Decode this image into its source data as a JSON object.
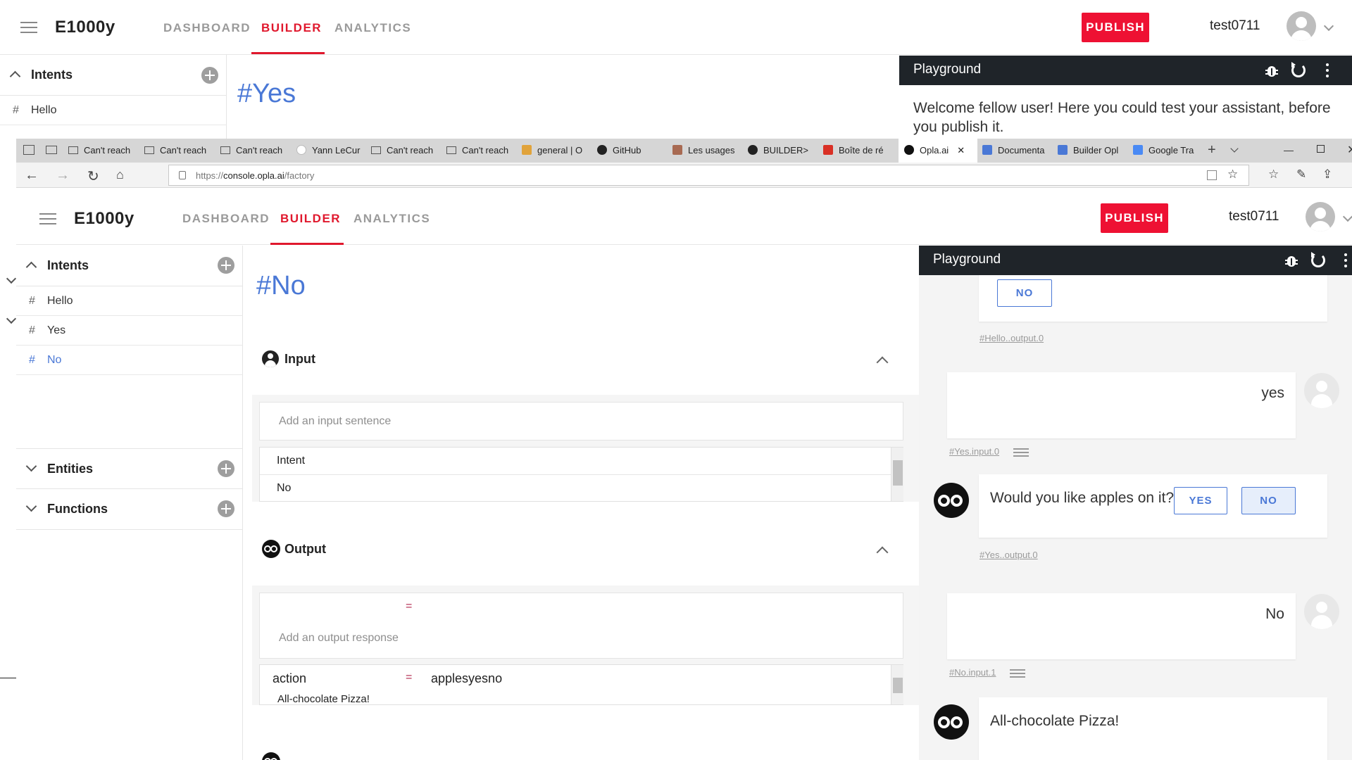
{
  "app": {
    "brand": "E1000y",
    "tabs": [
      "DASHBOARD",
      "BUILDER",
      "ANALYTICS"
    ],
    "publish_label": "PUBLISH",
    "username": "test0711"
  },
  "back": {
    "sidebar": {
      "intents_label": "Intents",
      "items": [
        {
          "hash": "#",
          "label": "Hello"
        }
      ]
    },
    "page_title": "#Yes",
    "playground": {
      "title": "Playground",
      "welcome": "Welcome fellow user! Here you could test your assistant, before you publish it."
    }
  },
  "browser": {
    "tabs": [
      {
        "label": "Can't reach"
      },
      {
        "label": "Can't reach"
      },
      {
        "label": "Can't reach"
      },
      {
        "label": "Yann LeCur"
      },
      {
        "label": "Can't reach"
      },
      {
        "label": "Can't reach"
      },
      {
        "label": "general | O"
      },
      {
        "label": "GitHub"
      },
      {
        "label": "Les usages"
      },
      {
        "label": "BUILDER>"
      },
      {
        "label": "Boîte de ré"
      },
      {
        "label": "Opla.ai"
      },
      {
        "label": "Documenta"
      },
      {
        "label": "Builder Opl"
      },
      {
        "label": "Google Tra"
      }
    ],
    "url_prefix": "https://",
    "url_host": "console.opla.ai",
    "url_path": "/factory"
  },
  "front": {
    "sidebar": {
      "intents_label": "Intents",
      "items": [
        {
          "hash": "#",
          "label": "Hello"
        },
        {
          "hash": "#",
          "label": "Yes"
        },
        {
          "hash": "#",
          "label": "No"
        }
      ],
      "entities_label": "Entities",
      "functions_label": "Functions"
    },
    "page_title": "#No",
    "input": {
      "title": "Input",
      "placeholder": "Add an input sentence",
      "rows": [
        "Intent",
        "No"
      ]
    },
    "output": {
      "title": "Output",
      "equals": "=",
      "placeholder": "Add an output response",
      "action_key": "action",
      "action_value": "applesyesno",
      "response": "All-chocolate Pizza!"
    },
    "playground": {
      "title": "Playground",
      "top_no_label": "NO",
      "link1": "#Hello..output.0",
      "user_msg1": "yes",
      "link2": "#Yes.input.0",
      "bot_question": "Would you like apples on it?",
      "yes_label": "YES",
      "no_label": "NO",
      "link3": "#Yes..output.0",
      "user_msg2": "No",
      "link4": "#No.input.1",
      "bot_answer": "All-chocolate Pizza!"
    }
  }
}
